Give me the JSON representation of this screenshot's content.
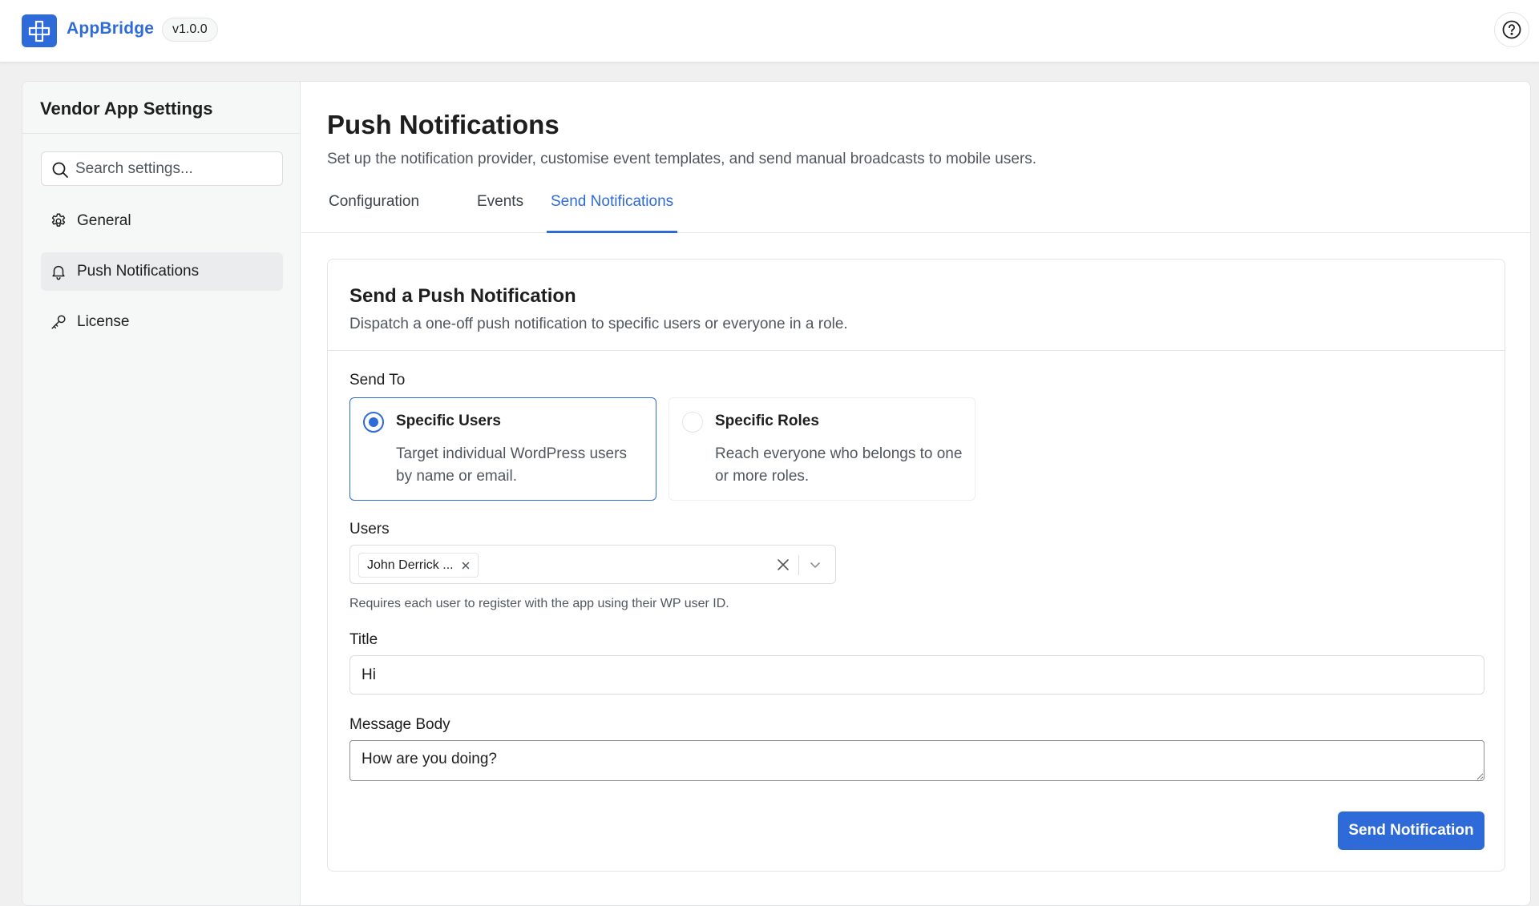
{
  "app": {
    "brand": "AppBridge",
    "version": "v1.0.0",
    "accent_color": "#2f6bd8",
    "logo_icon": "plus-cross-logo-icon",
    "help_icon": "question-circle-icon"
  },
  "sidebar": {
    "title": "Vendor App Settings",
    "search_placeholder": "Search settings...",
    "items": [
      {
        "label": "General",
        "icon": "gear-icon",
        "active": false
      },
      {
        "label": "Push Notifications",
        "icon": "bell-icon",
        "active": true
      },
      {
        "label": "License",
        "icon": "key-icon",
        "active": false
      }
    ]
  },
  "page": {
    "title": "Push Notifications",
    "description": "Set up the notification provider, customise event templates, and send manual broadcasts to mobile users.",
    "tabs": [
      {
        "label": "Configuration",
        "active": false
      },
      {
        "label": "Events",
        "active": false
      },
      {
        "label": "Send Notifications",
        "active": true
      }
    ]
  },
  "panel": {
    "title": "Send a Push Notification",
    "subtitle": "Dispatch a one-off push notification to specific users or everyone in a role.",
    "send_to_label": "Send To",
    "options": [
      {
        "title": "Specific Users",
        "description": "Target individual WordPress users by name or email.",
        "selected": true
      },
      {
        "title": "Specific Roles",
        "description": "Reach everyone who belongs to one or more roles.",
        "selected": false
      }
    ],
    "users_label": "Users",
    "selected_users": [
      "John Derrick ..."
    ],
    "users_help": "Requires each user to register with the app using their WP user ID.",
    "title_label": "Title",
    "title_value": "Hi",
    "body_label": "Message Body",
    "body_value": "How are you doing?",
    "send_button": "Send Notification"
  }
}
